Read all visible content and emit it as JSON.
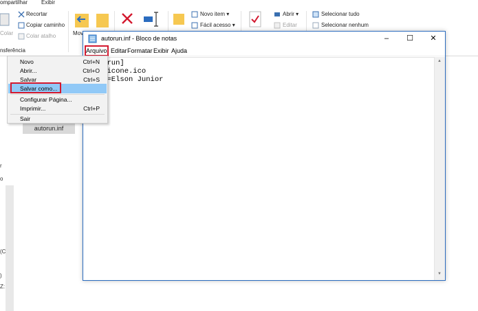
{
  "explorer": {
    "tabs": [
      "ompartilhar",
      "Exibir"
    ],
    "ribbon": {
      "colar": "Colar",
      "recortar": "Recortar",
      "copiar_caminho": "Copiar caminho",
      "colar_atalho": "Colar atalho",
      "area_transferencia": "nsferência",
      "mover_para": "Mov para",
      "novo_item": "Novo item",
      "facil_acesso": "Fácil acesso",
      "abrir": "Abrir",
      "editar": "Editar",
      "selecionar_tudo": "Selecionar tudo",
      "selecionar_nenhum": "Selecionar nenhum"
    },
    "left_fragments": [
      "r",
      "o",
      "(C",
      ")",
      "Z:"
    ],
    "file_item": "autorun.inf"
  },
  "notepad": {
    "title": "autorun.inf - Bloco de notas",
    "menu": [
      "Arquivo",
      "Editar",
      "Formatar",
      "Exibir",
      "Ajuda"
    ],
    "content": "[autorun]\nicon=icone.ico\nlabel=Elson Junior"
  },
  "file_menu": {
    "items": [
      {
        "label": "Novo",
        "shortcut": "Ctrl+N"
      },
      {
        "label": "Abrir...",
        "shortcut": "Ctrl+O"
      },
      {
        "label": "Salvar",
        "shortcut": "Ctrl+S"
      },
      {
        "label": "Salvar como...",
        "shortcut": ""
      },
      {
        "label": "Configurar Página...",
        "shortcut": ""
      },
      {
        "label": "Imprimir...",
        "shortcut": "Ctrl+P"
      },
      {
        "label": "Sair",
        "shortcut": ""
      }
    ],
    "selected": "Salvar como..."
  },
  "colors": {
    "highlight_red": "#d3182e",
    "menu_selection": "#91c9f7",
    "window_border": "#2b6cbf"
  }
}
